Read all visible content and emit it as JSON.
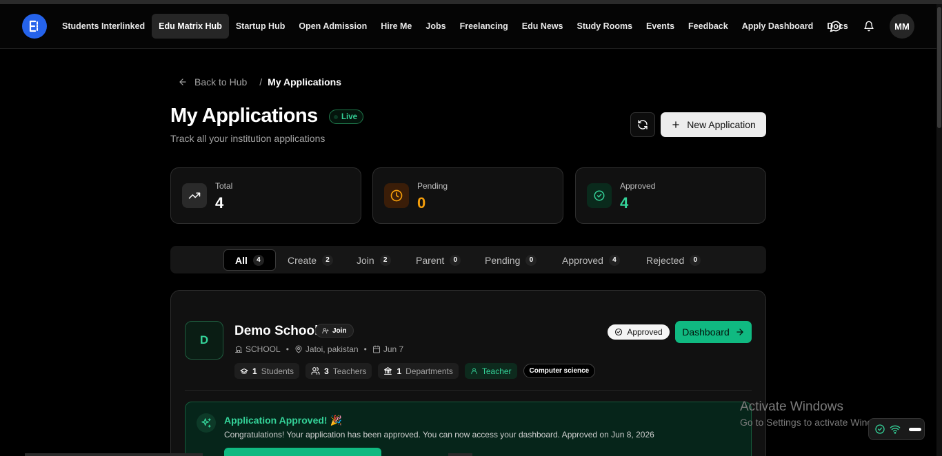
{
  "nav": {
    "items": [
      {
        "label": "Students Interlinked",
        "active": false
      },
      {
        "label": "Edu Matrix Hub",
        "active": true
      },
      {
        "label": "Startup Hub",
        "active": false
      },
      {
        "label": "Open Admission",
        "active": false
      },
      {
        "label": "Hire Me",
        "active": false
      },
      {
        "label": "Jobs",
        "active": false
      },
      {
        "label": "Freelancing",
        "active": false
      },
      {
        "label": "Edu News",
        "active": false
      },
      {
        "label": "Study Rooms",
        "active": false
      },
      {
        "label": "Events",
        "active": false
      },
      {
        "label": "Feedback",
        "active": false
      },
      {
        "label": "Apply Dashboard",
        "active": false
      },
      {
        "label": "Docs",
        "active": false
      }
    ],
    "avatar_initials": "MM"
  },
  "breadcrumb": {
    "back_label": "Back to Hub",
    "separator": "/",
    "current": "My Applications"
  },
  "header": {
    "title": "My Applications",
    "live_label": "Live",
    "subtitle": "Track all your institution applications",
    "new_button_label": "New Application"
  },
  "stats": [
    {
      "label": "Total",
      "value": "4",
      "color": "#ffffff"
    },
    {
      "label": "Pending",
      "value": "0",
      "color": "#f59e0b"
    },
    {
      "label": "Approved",
      "value": "4",
      "color": "#34d399"
    }
  ],
  "tabs": [
    {
      "label": "All",
      "count": "4",
      "active": true
    },
    {
      "label": "Create",
      "count": "2",
      "active": false
    },
    {
      "label": "Join",
      "count": "2",
      "active": false
    },
    {
      "label": "Parent",
      "count": "0",
      "active": false
    },
    {
      "label": "Pending",
      "count": "0",
      "active": false
    },
    {
      "label": "Approved",
      "count": "4",
      "active": false
    },
    {
      "label": "Rejected",
      "count": "0",
      "active": false
    }
  ],
  "application": {
    "initial": "D",
    "name": "Demo School",
    "type_badge": "Join",
    "category": "SCHOOL",
    "location": "Jatoi, pakistan",
    "date": "Jun 7",
    "status": "Approved",
    "dashboard_label": "Dashboard",
    "students_count": "1",
    "students_label": "Students",
    "teachers_count": "3",
    "teachers_label": "Teachers",
    "departments_count": "1",
    "departments_label": "Departments",
    "role": "Teacher",
    "subject": "Computer science",
    "approved_title": "Application Approved! 🎉",
    "approved_text": "Congratulations! Your application has been approved. You can now access your dashboard. Approved on Jun 8, 2026"
  },
  "watermark": {
    "title": "Activate Windows",
    "subtitle": "Go to Settings to activate Windows."
  },
  "colors": {
    "accent_green": "#10b981",
    "brand_blue": "#2563eb",
    "pending_orange": "#f59e0b"
  }
}
